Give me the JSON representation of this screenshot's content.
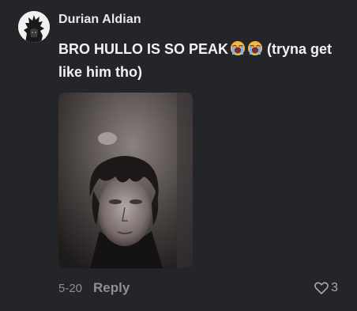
{
  "comment": {
    "username": "Durian Aldian",
    "text_main": "BRO HULLO IS SO PEAK",
    "emojis": [
      "loudly-crying-face",
      "loudly-crying-face"
    ],
    "text_tail": " (tryna get like him tho)",
    "date": "5-20",
    "reply_label": "Reply",
    "like_count": "3"
  },
  "icons": {
    "like": "heart-outline-icon"
  },
  "colors": {
    "background": "#232528",
    "username": "#e9e9ea",
    "meta_text": "#8e8f93"
  }
}
